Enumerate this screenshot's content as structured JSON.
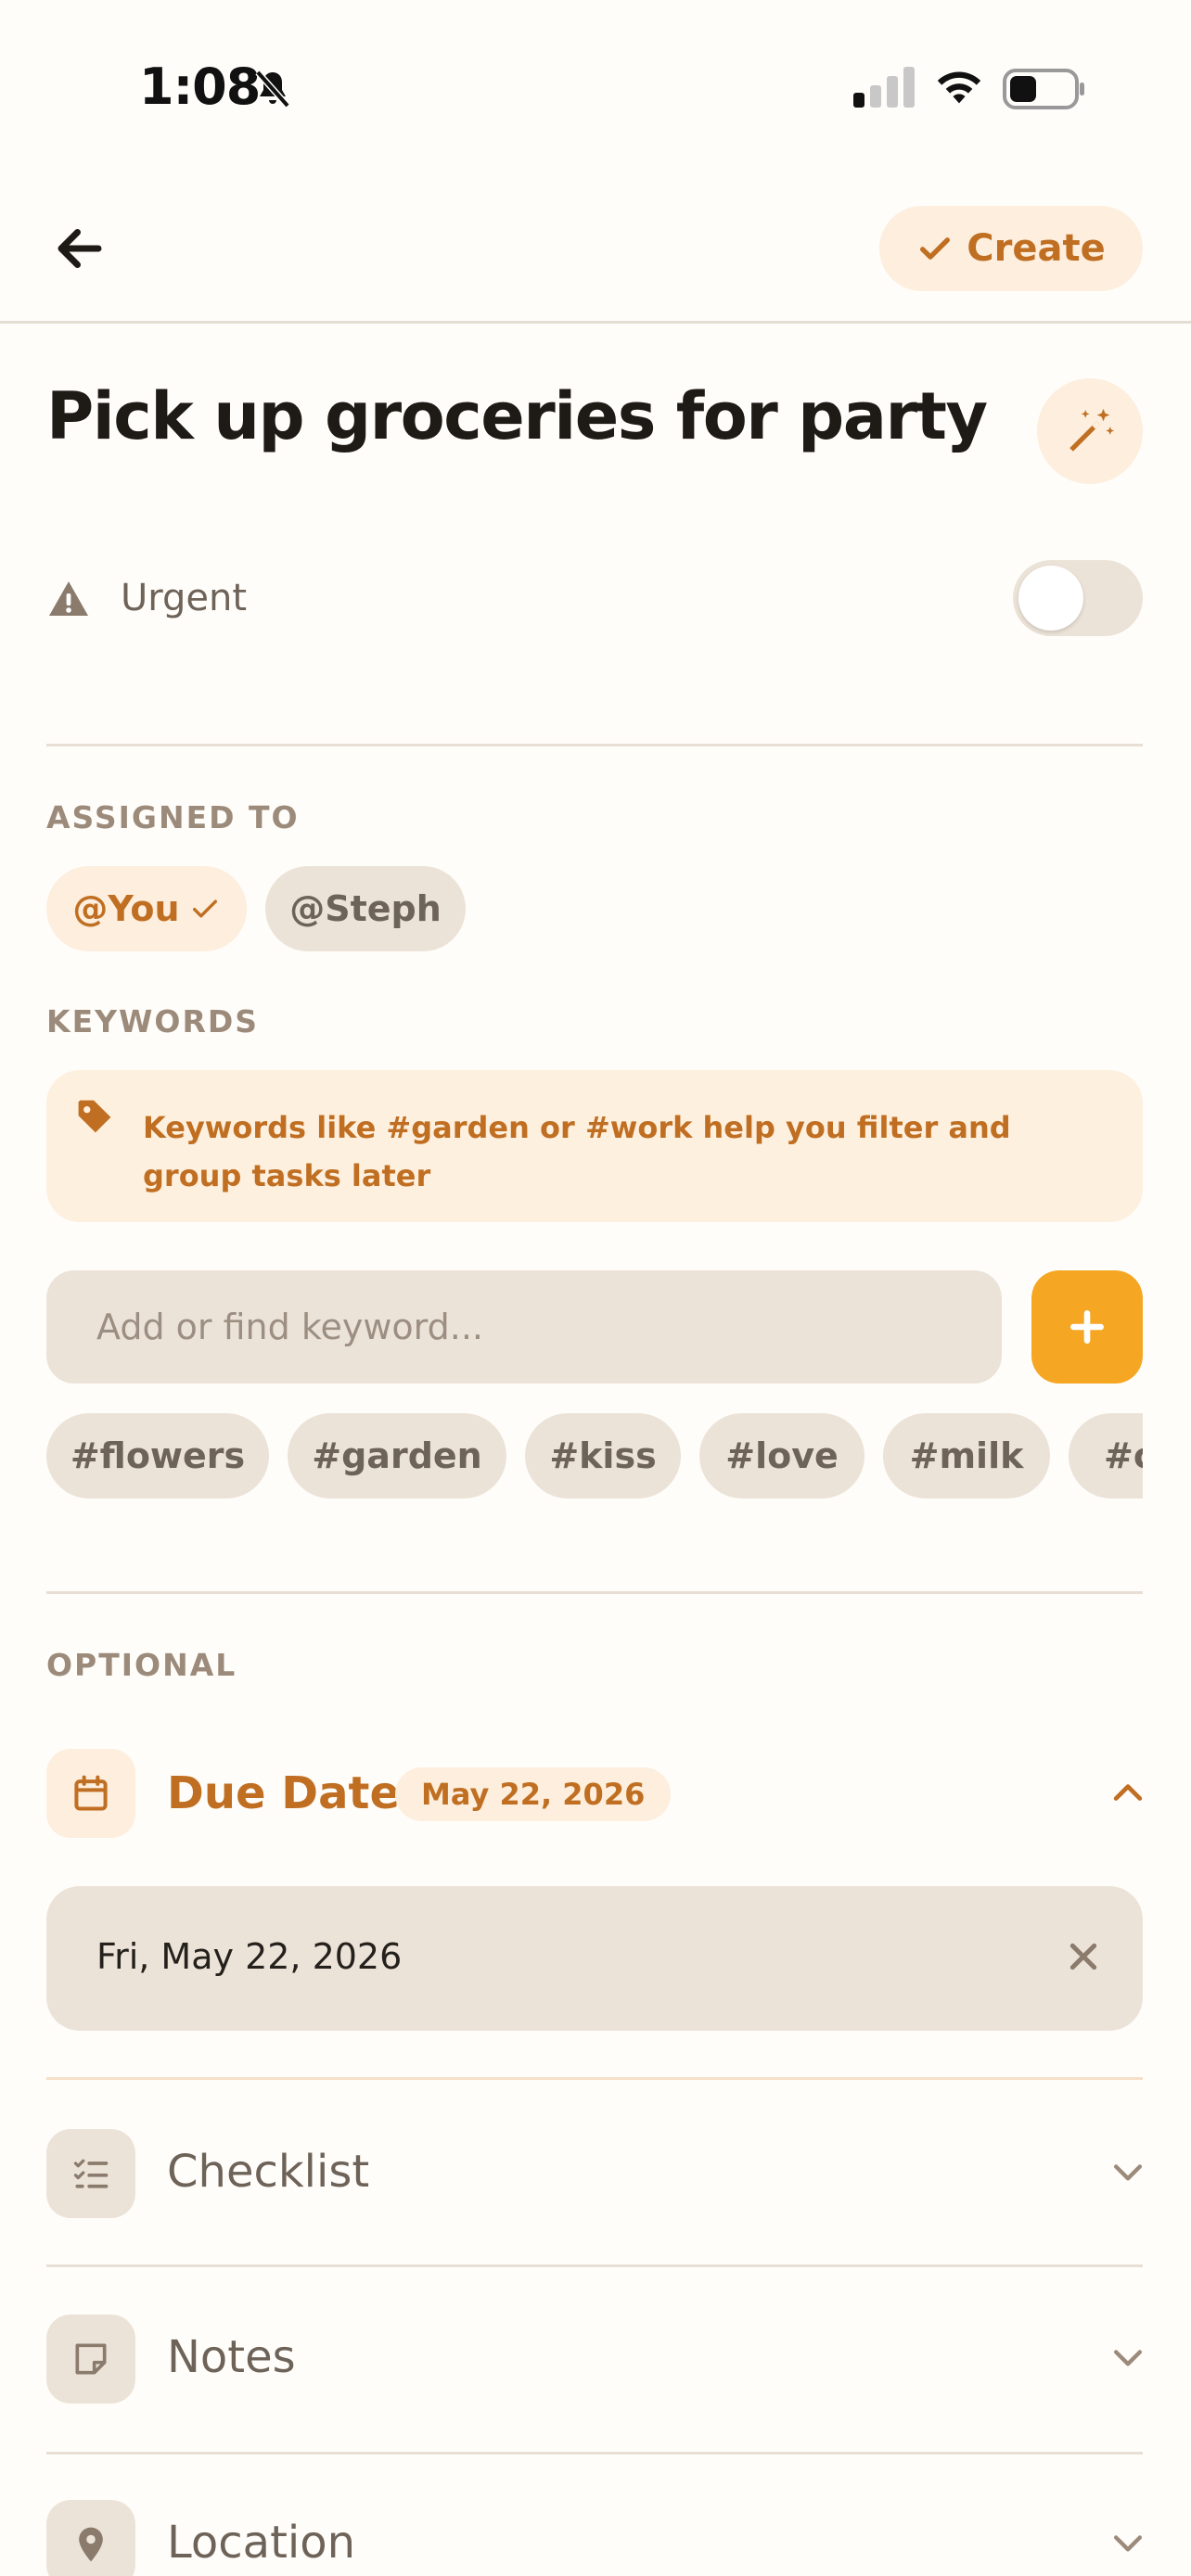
{
  "status_bar": {
    "time": "1:08"
  },
  "header": {
    "create_label": "Create"
  },
  "task": {
    "title": "Pick up groceries for party"
  },
  "urgent": {
    "label": "Urgent",
    "enabled": false
  },
  "assigned": {
    "section_label": "ASSIGNED TO",
    "chips": [
      {
        "label": "@You",
        "selected": true
      },
      {
        "label": "@Steph",
        "selected": false
      }
    ]
  },
  "keywords": {
    "section_label": "KEYWORDS",
    "hint": "Keywords like #garden or #work help you filter and group tasks later",
    "input_placeholder": "Add or find keyword...",
    "input_value": "",
    "tags": [
      "#flowers",
      "#garden",
      "#kiss",
      "#love",
      "#milk",
      "#c"
    ]
  },
  "optional": {
    "section_label": "OPTIONAL",
    "due_date": {
      "label": "Due Date",
      "badge": "May 22, 2026",
      "field_value": "Fri, May 22, 2026",
      "expanded": true
    },
    "checklist": {
      "label": "Checklist"
    },
    "notes": {
      "label": "Notes"
    },
    "location": {
      "label": "Location"
    }
  },
  "colors": {
    "accent": "#c06f22",
    "accent_bg": "#fdeedd",
    "add_button": "#f5a623",
    "neutral_bg": "#ece3d8",
    "page_bg": "#fffdfa"
  }
}
